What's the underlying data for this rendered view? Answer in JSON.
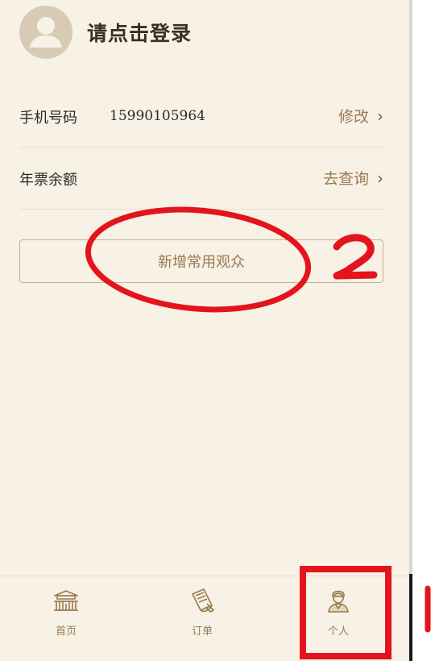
{
  "header": {
    "login_prompt": "请点击登录",
    "avatar_icon": "user-avatar-icon"
  },
  "rows": {
    "phone": {
      "label": "手机号码",
      "value": "15990105964",
      "action": "修改",
      "chevron": "›"
    },
    "balance": {
      "label": "年票余额",
      "action": "去查询",
      "chevron": "›"
    }
  },
  "add_viewer_button": {
    "label": "新增常用观众"
  },
  "annotations": {
    "step_number": "2"
  },
  "tabbar": {
    "items": [
      {
        "label": "首页",
        "icon": "palace-icon"
      },
      {
        "label": "订单",
        "icon": "order-icon"
      },
      {
        "label": "个人",
        "icon": "person-icon"
      }
    ]
  },
  "colors": {
    "background": "#f7f1e6",
    "accent": "#9a7a4f",
    "annotation_red": "#e3141c"
  }
}
